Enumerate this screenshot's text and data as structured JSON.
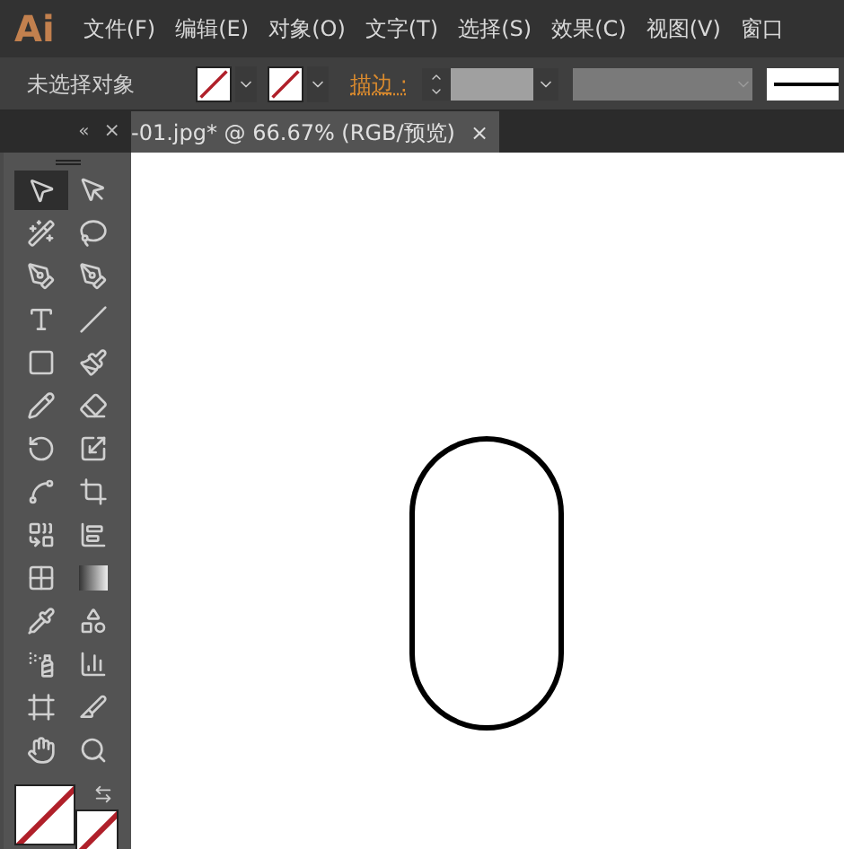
{
  "app": {
    "logo": "Ai"
  },
  "menu": [
    "文件(F)",
    "编辑(E)",
    "对象(O)",
    "文字(T)",
    "选择(S)",
    "效果(C)",
    "视图(V)",
    "窗口"
  ],
  "control_bar": {
    "selection_label": "未选择对象",
    "stroke_label": "描边 :"
  },
  "document_tab": {
    "title": "-01.jpg* @ 66.67% (RGB/预览)",
    "close": "×"
  },
  "tools_panel": {
    "collapse": "«",
    "close": "×",
    "tools": [
      {
        "kind": "selection",
        "selected": true
      },
      {
        "kind": "direct",
        "selected": false
      },
      {
        "kind": "wand",
        "selected": false
      },
      {
        "kind": "lasso",
        "selected": false
      },
      {
        "kind": "pen",
        "selected": false
      },
      {
        "kind": "curvature",
        "selected": false
      },
      {
        "kind": "type",
        "selected": false
      },
      {
        "kind": "line",
        "selected": false
      },
      {
        "kind": "rectangle",
        "selected": false
      },
      {
        "kind": "brush",
        "selected": false
      },
      {
        "kind": "pencil",
        "selected": false
      },
      {
        "kind": "eraser",
        "selected": false
      },
      {
        "kind": "rotate",
        "selected": false
      },
      {
        "kind": "scale",
        "selected": false
      },
      {
        "kind": "warp",
        "selected": false
      },
      {
        "kind": "transform",
        "selected": false
      },
      {
        "kind": "shapebuilder",
        "selected": false
      },
      {
        "kind": "perspective",
        "selected": false
      },
      {
        "kind": "mesh",
        "selected": false
      },
      {
        "kind": "gradient",
        "selected": false
      },
      {
        "kind": "eyedropper",
        "selected": false
      },
      {
        "kind": "blend",
        "selected": false
      },
      {
        "kind": "sprayer",
        "selected": false
      },
      {
        "kind": "graph",
        "selected": false
      },
      {
        "kind": "artboard",
        "selected": false
      },
      {
        "kind": "slice",
        "selected": false
      },
      {
        "kind": "hand",
        "selected": false
      },
      {
        "kind": "zoom",
        "selected": false
      }
    ]
  }
}
